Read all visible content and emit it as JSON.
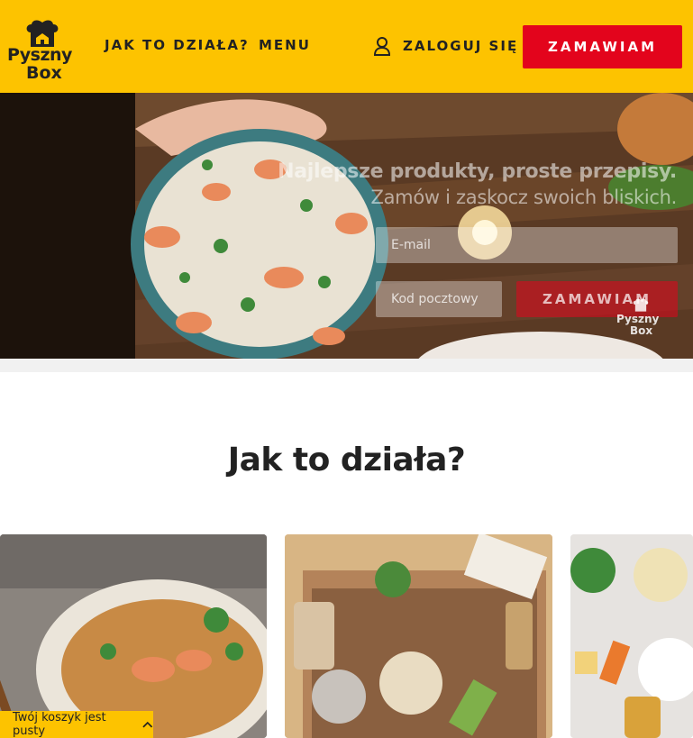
{
  "brand": {
    "logo_line1": "Pyszny",
    "logo_line2": "Box"
  },
  "nav": {
    "how_it_works": "JAK TO DZIAŁA?",
    "menu": "MENU",
    "login": "ZALOGUJ SIĘ",
    "order": "ZAMAWIAM"
  },
  "hero": {
    "title": "Najlepsze produkty, proste przepisy.",
    "subtitle": "Zamów i zaskocz swoich bliskich.",
    "email_placeholder": "E-mail",
    "zip_placeholder": "Kod pocztowy",
    "order_button": "ZAMAWIAM",
    "logo_line1": "Pyszny",
    "logo_line2": "Box"
  },
  "how_section": {
    "title": "Jak to działa?"
  },
  "cart": {
    "label": "Twój koszyk jest pusty"
  },
  "icons": [
    "chef-hat-icon",
    "user-icon",
    "chevron-up-icon"
  ],
  "colors": {
    "brand_yellow": "#fdc300",
    "accent_red": "#e3041c",
    "text_dark": "#222222"
  }
}
